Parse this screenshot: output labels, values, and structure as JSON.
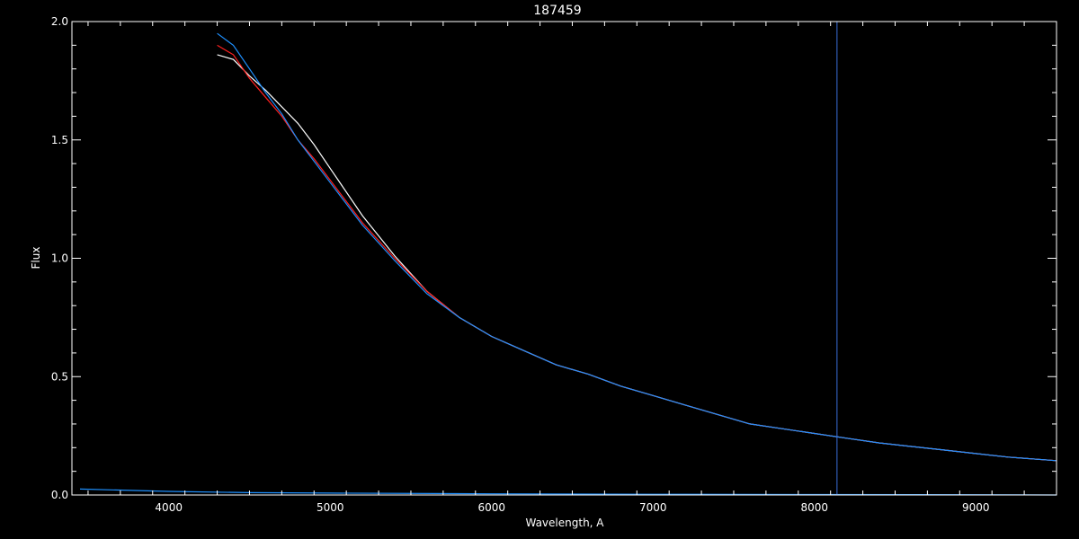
{
  "chart_data": {
    "type": "line",
    "title": "187459",
    "xlabel": "Wavelength, A",
    "ylabel": "Flux",
    "xlim": [
      3400,
      9500
    ],
    "ylim": [
      0.0,
      2.0
    ],
    "x_ticks": [
      "4000",
      "5000",
      "6000",
      "7000",
      "8000",
      "9000"
    ],
    "y_ticks": [
      "0.0",
      "0.5",
      "1.0",
      "1.5",
      "2.0"
    ],
    "grid": false,
    "background": "#000000",
    "series": [
      {
        "color": "#ffffff",
        "x": [
          4300,
          4400,
          4500,
          4600,
          4700,
          4800,
          4900,
          5000,
          5200,
          5400,
          5600,
          5800,
          6000,
          6200,
          6400,
          6600,
          6800,
          7000,
          7200,
          7400,
          7600,
          7800,
          8000,
          8200,
          8400,
          8600,
          8800,
          9000,
          9200,
          9500
        ],
        "y": [
          1.86,
          1.84,
          1.77,
          1.71,
          1.64,
          1.57,
          1.48,
          1.38,
          1.18,
          1.01,
          0.86,
          0.75,
          0.67,
          0.61,
          0.55,
          0.51,
          0.46,
          0.42,
          0.38,
          0.34,
          0.3,
          0.28,
          0.26,
          0.24,
          0.22,
          0.205,
          0.19,
          0.175,
          0.16,
          0.145
        ]
      },
      {
        "color": "#ff2020",
        "x": [
          4300,
          4400,
          4500,
          4600,
          4700,
          4800,
          4900,
          5000,
          5200,
          5400,
          5600,
          5800,
          6000,
          6200,
          6400,
          6600,
          6800,
          7000,
          7200,
          7400,
          7600,
          7800,
          8000,
          8200,
          8400,
          8600,
          8800,
          9000,
          9200,
          9500
        ],
        "y": [
          1.9,
          1.86,
          1.76,
          1.68,
          1.6,
          1.5,
          1.42,
          1.33,
          1.15,
          1.0,
          0.86,
          0.75,
          0.67,
          0.61,
          0.55,
          0.51,
          0.46,
          0.42,
          0.38,
          0.34,
          0.3,
          0.28,
          0.26,
          0.24,
          0.22,
          0.205,
          0.19,
          0.175,
          0.16,
          0.145
        ]
      },
      {
        "color": "#1e90ff",
        "x": [
          4300,
          4400,
          4500,
          4600,
          4700,
          4800,
          4900,
          5000,
          5200,
          5400,
          5600,
          5800,
          6000,
          6200,
          6400,
          6600,
          6800,
          7000,
          7200,
          7400,
          7600,
          7800,
          8000,
          8200,
          8400,
          8600,
          8800,
          9000,
          9200,
          9500
        ],
        "y": [
          1.95,
          1.9,
          1.8,
          1.7,
          1.61,
          1.5,
          1.41,
          1.32,
          1.14,
          0.99,
          0.85,
          0.75,
          0.67,
          0.61,
          0.55,
          0.51,
          0.46,
          0.42,
          0.38,
          0.34,
          0.3,
          0.28,
          0.26,
          0.24,
          0.22,
          0.205,
          0.19,
          0.175,
          0.16,
          0.145
        ]
      },
      {
        "color": "#1e90ff",
        "x": [
          3450,
          4000,
          4500,
          5000,
          6000,
          7000,
          8000,
          9000,
          9500
        ],
        "y": [
          0.025,
          0.015,
          0.01,
          0.008,
          0.005,
          0.003,
          0.002,
          0.001,
          0.0
        ]
      }
    ],
    "vertical_line": {
      "x": 8140,
      "color": "#3a6fd8"
    }
  }
}
